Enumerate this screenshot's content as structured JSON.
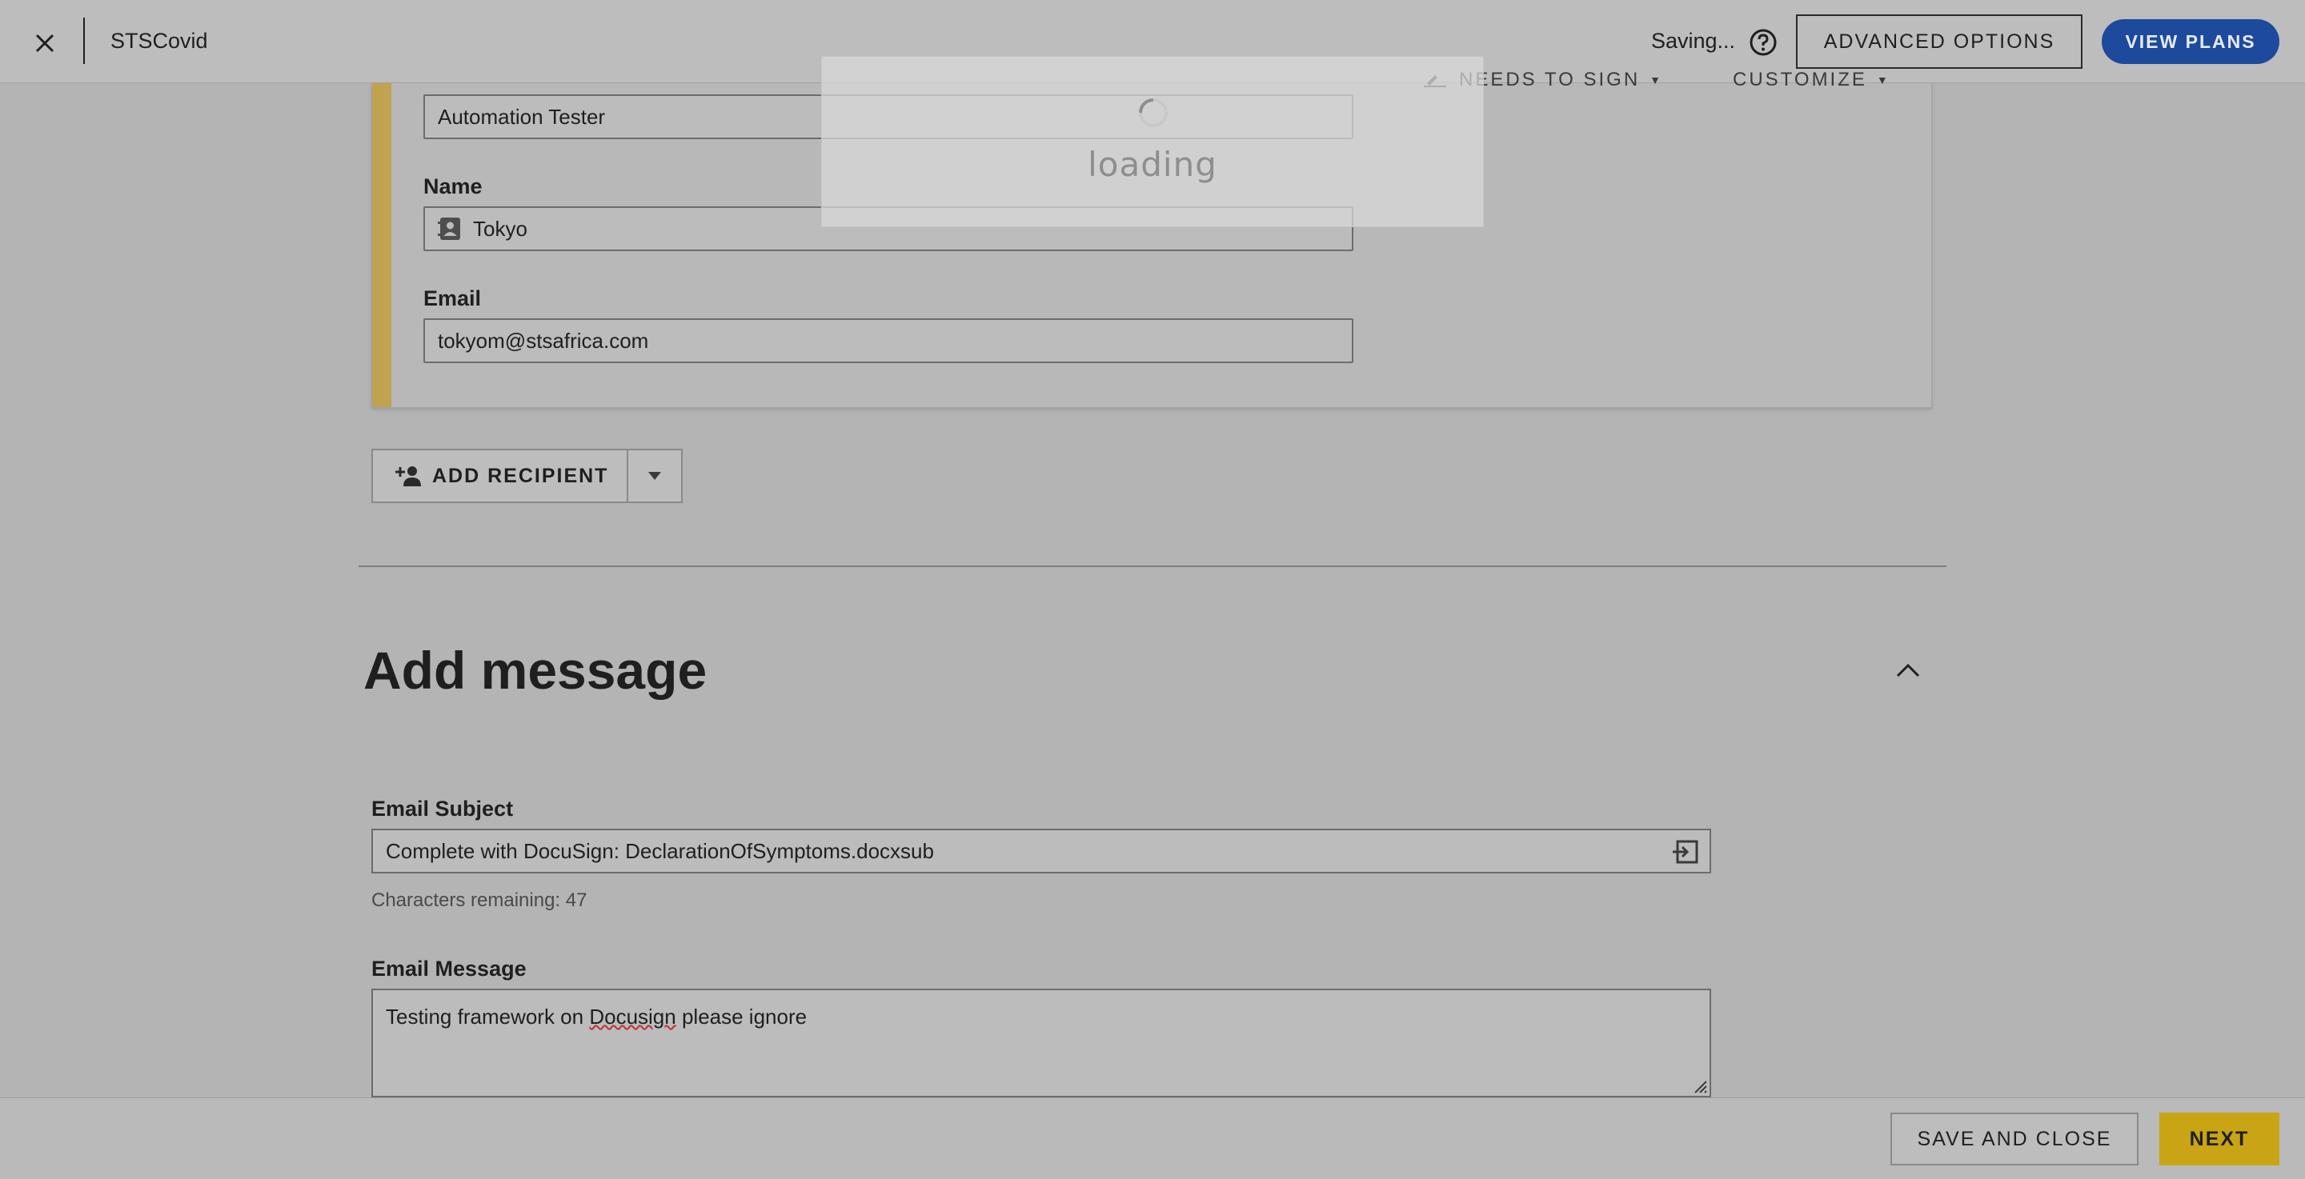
{
  "header": {
    "app_title": "STSCovid",
    "status": "Saving...",
    "advanced_options_label": "ADVANCED OPTIONS",
    "view_plans_label": "VIEW PLANS"
  },
  "recipient": {
    "role_value": "Automation Tester",
    "action_label": "NEEDS TO SIGN",
    "customize_label": "CUSTOMIZE",
    "name_label": "Name",
    "name_value": "Tokyo",
    "email_label": "Email",
    "email_value": "tokyom@stsafrica.com",
    "accent_color": "#c0a250"
  },
  "add_recipient": {
    "label": "ADD RECIPIENT"
  },
  "message": {
    "section_title": "Add message",
    "subject_label": "Email Subject",
    "subject_value": "Complete with DocuSign: DeclarationOfSymptoms.docxsub",
    "chars_remaining": "Characters remaining: 47",
    "message_label": "Email Message",
    "message_before": "Testing framework on ",
    "message_misspelled": "Docusign",
    "message_after": " please ignore"
  },
  "footer": {
    "save_close_label": "SAVE AND CLOSE",
    "next_label": "NEXT",
    "next_color": "#c9a414"
  },
  "loading": {
    "text": "loading"
  },
  "colors": {
    "primary_blue": "#1d4a9c",
    "overlay_background": "#b4b4b4"
  },
  "icons": {
    "close": "close-icon",
    "help": "help-icon",
    "contact": "contact-card-icon",
    "add_person": "add-person-icon",
    "caret": "caret-down-icon",
    "collapse": "chevron-up-icon",
    "insert": "insert-field-icon",
    "spinner": "spinner-icon"
  }
}
